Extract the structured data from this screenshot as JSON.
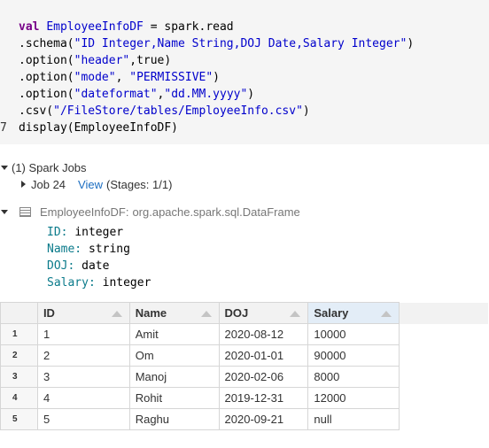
{
  "code": {
    "lines": [
      {
        "num": "",
        "tokens": [
          {
            "t": "val ",
            "c": "kw"
          },
          {
            "t": "EmployeeInfoDF",
            "c": "ident"
          },
          {
            "t": " = spark.read",
            "c": "plain"
          }
        ]
      },
      {
        "num": "",
        "tokens": [
          {
            "t": ".schema(",
            "c": "plain"
          },
          {
            "t": "\"ID Integer,Name String,DOJ Date,Salary Integer\"",
            "c": "ident"
          },
          {
            "t": ")",
            "c": "plain"
          }
        ]
      },
      {
        "num": "",
        "tokens": [
          {
            "t": ".option(",
            "c": "plain"
          },
          {
            "t": "\"header\"",
            "c": "ident"
          },
          {
            "t": ",true)",
            "c": "plain"
          }
        ]
      },
      {
        "num": "",
        "tokens": [
          {
            "t": ".option(",
            "c": "plain"
          },
          {
            "t": "\"mode\"",
            "c": "ident"
          },
          {
            "t": ", ",
            "c": "plain"
          },
          {
            "t": "\"PERMISSIVE\"",
            "c": "ident"
          },
          {
            "t": ")",
            "c": "plain"
          }
        ]
      },
      {
        "num": "",
        "tokens": [
          {
            "t": ".option(",
            "c": "plain"
          },
          {
            "t": "\"dateformat\"",
            "c": "ident"
          },
          {
            "t": ",",
            "c": "plain"
          },
          {
            "t": "\"dd.MM.yyyy\"",
            "c": "ident"
          },
          {
            "t": ")",
            "c": "plain"
          }
        ]
      },
      {
        "num": "",
        "tokens": [
          {
            "t": ".csv(",
            "c": "plain"
          },
          {
            "t": "\"/FileStore/tables/EmployeeInfo.csv\"",
            "c": "ident"
          },
          {
            "t": ")",
            "c": "plain"
          }
        ]
      },
      {
        "num": "7",
        "tokens": [
          {
            "t": "display(EmployeeInfoDF)",
            "c": "plain"
          }
        ]
      }
    ]
  },
  "jobs": {
    "title": "(1) Spark Jobs",
    "job_label": "Job 24",
    "view_label": "View",
    "stages": "(Stages: 1/1)"
  },
  "schema": {
    "df_name": "EmployeeInfoDF:",
    "df_type": "org.apache.spark.sql.DataFrame",
    "fields": [
      {
        "name": "ID:",
        "type": "integer"
      },
      {
        "name": "Name:",
        "type": "string"
      },
      {
        "name": "DOJ:",
        "type": "date"
      },
      {
        "name": "Salary:",
        "type": "integer"
      }
    ]
  },
  "table": {
    "columns": [
      "ID",
      "Name",
      "DOJ",
      "Salary"
    ],
    "rows": [
      {
        "n": "1",
        "cells": [
          "1",
          "Amit",
          "2020-08-12",
          "10000"
        ]
      },
      {
        "n": "2",
        "cells": [
          "2",
          "Om",
          "2020-01-01",
          "90000"
        ]
      },
      {
        "n": "3",
        "cells": [
          "3",
          "Manoj",
          "2020-02-06",
          "8000"
        ]
      },
      {
        "n": "4",
        "cells": [
          "4",
          "Rohit",
          "2019-12-31",
          "12000"
        ]
      },
      {
        "n": "5",
        "cells": [
          "5",
          "Raghu",
          "2020-09-21",
          "null"
        ]
      }
    ]
  },
  "colors": {
    "keyword": "#770088",
    "identifier": "#0000cc",
    "link": "#1b6dc1",
    "field_name": "#0b7b8b",
    "active_header": "#e3edf7"
  },
  "icons": [
    "expand-triangle-icon",
    "collapse-triangle-icon",
    "dataframe-icon",
    "sort-ascending-icon"
  ]
}
